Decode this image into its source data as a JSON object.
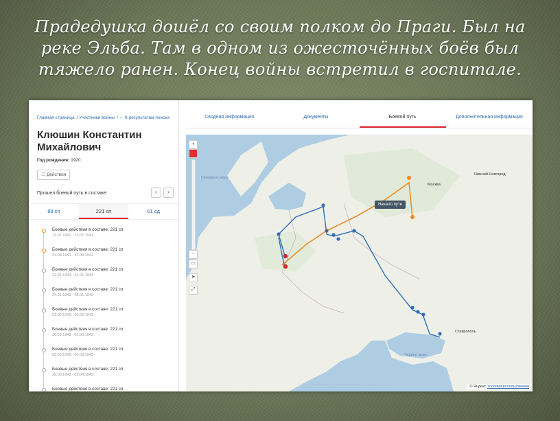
{
  "headline": "Прадедушка дошёл со своим полком до Праги. Был на реке Эльба. Там в одном из ожесточённых боёв был тяжело ранен. Конец войны встретил в госпитале.",
  "breadcrumbs": [
    "Главная страница",
    "Участники войны",
    "← К результатам поиска"
  ],
  "person": {
    "name": "Клюшин Константин Михайлович",
    "birth_label": "Год рождения:",
    "birth_year": "1920",
    "actions_label": "Действия"
  },
  "path": {
    "header": "Прошел боевой путь в составе:",
    "prev_icon": "chevron-left-icon",
    "next_icon": "chevron-right-icon",
    "units": [
      {
        "label": "88 сп",
        "active": false
      },
      {
        "label": "221 сп",
        "active": true
      },
      {
        "label": "61 сд",
        "active": false
      }
    ],
    "events": [
      {
        "title": "Боевые действия в составе: 221 сп",
        "dates": "13.07.1941 - 13.07.1941",
        "color": "#f08a24"
      },
      {
        "title": "Боевые действия в составе: 221 сп",
        "dates": "31.08.1941 - 31.08.1941",
        "color": "#f08a24"
      },
      {
        "title": "Боевые действия в составе: 221 сп",
        "dates": "21.01.1943 - 24.01.1943",
        "color": "#9aa9b8"
      },
      {
        "title": "Боевые действия в составе: 221 сп",
        "dates": "24.01.1943 - 28.01.1943",
        "color": "#9aa9b8"
      },
      {
        "title": "Боевые действия в составе: 221 сп",
        "dates": "01.02.1943 - 03.02.1943",
        "color": "#9aa9b8"
      },
      {
        "title": "Боевые действия в составе: 221 сп",
        "dates": "26.02.1943 - 02.03.1943",
        "color": "#9aa9b8"
      },
      {
        "title": "Боевые действия в составе: 221 сп",
        "dates": "03.03.1943 - 05.03.1943",
        "color": "#9aa9b8"
      },
      {
        "title": "Боевые действия в составе: 221 сп",
        "dates": "29.03.1943 - 02.04.1943",
        "color": "#9aa9b8"
      },
      {
        "title": "Боевые действия в составе: 221 сп",
        "dates": "",
        "color": "#9aa9b8"
      }
    ]
  },
  "tabs": [
    {
      "label": "Сводная информация",
      "active": false
    },
    {
      "label": "Документы",
      "active": false
    },
    {
      "label": "Боевой путь",
      "active": true
    },
    {
      "label": "Дополнительная информация",
      "active": false
    }
  ],
  "map": {
    "zoom_in": "+",
    "zoom_out": "−",
    "start_label": "Начало пути",
    "sea_labels": [
      "Северное море",
      "Черное море"
    ],
    "cities": [
      "Москва",
      "Нижний Новгород",
      "Ставрополь"
    ],
    "copyright_prefix": "© Яндекс",
    "terms_link": "Условия использования",
    "route_colors": {
      "orange": "#f08a24",
      "blue": "#2f6fb5",
      "red": "#d9252b"
    }
  }
}
